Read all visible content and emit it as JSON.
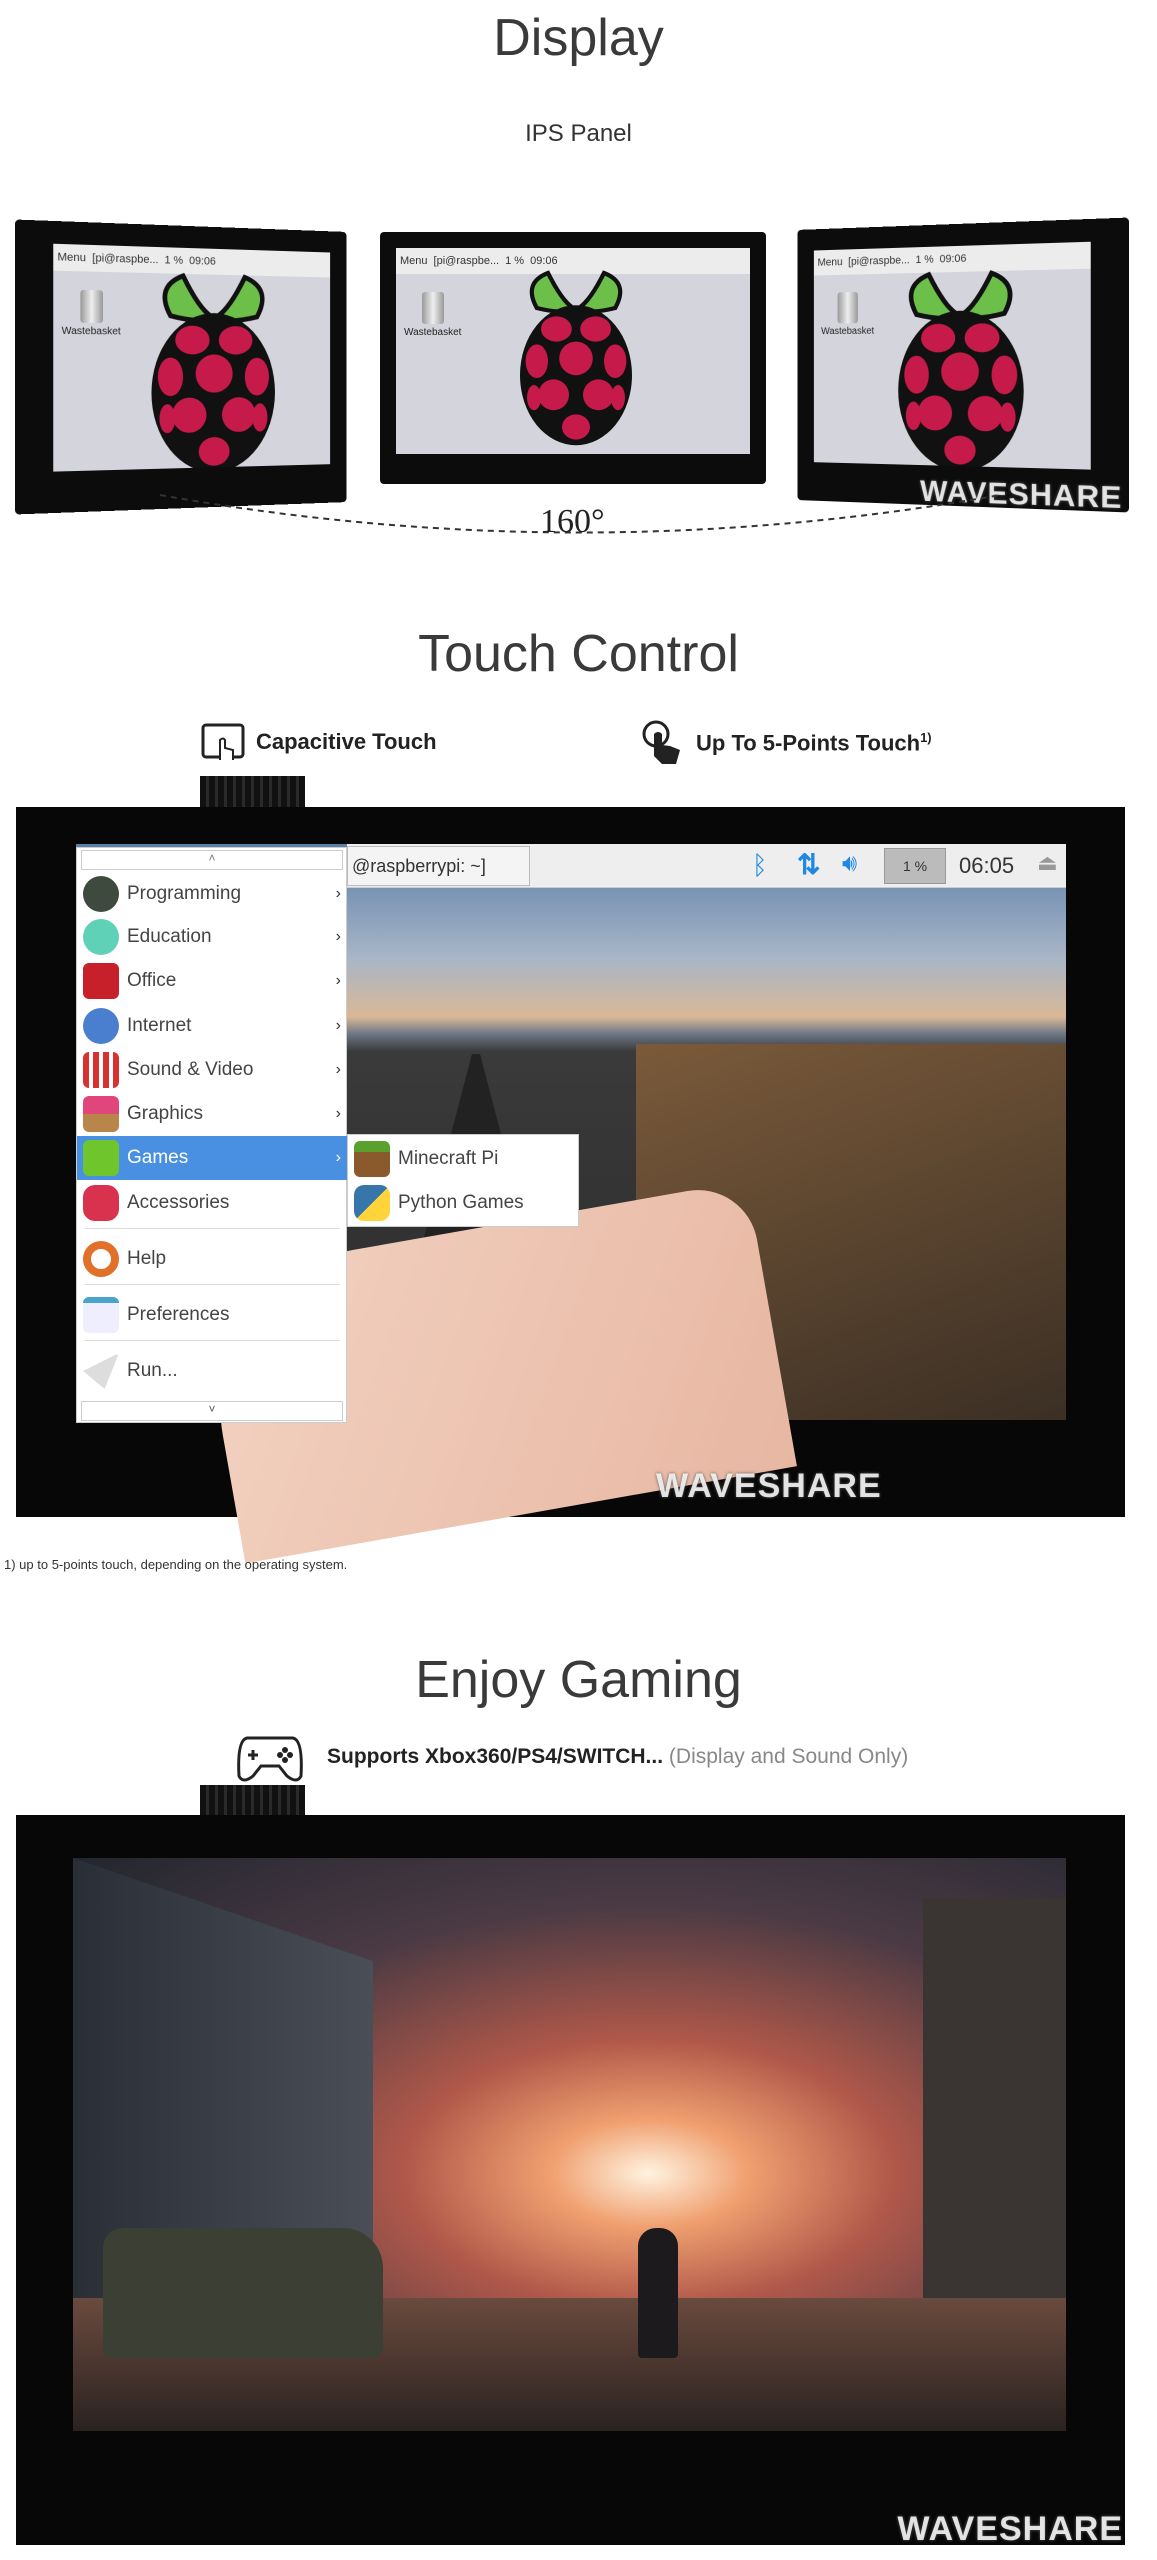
{
  "display": {
    "title": "Display",
    "subtitle": "IPS Panel",
    "angle": "160°",
    "screen": {
      "menu": "Menu",
      "terminal": "[pi@raspbe...",
      "cpu": "1 %",
      "time": "09:06",
      "desktop_icon": "Wastebasket"
    }
  },
  "touch": {
    "title": "Touch Control",
    "features": [
      {
        "label": "Capacitive Touch",
        "icon": "tablet-touch-icon"
      },
      {
        "label": "Up To 5-Points Touch",
        "sup": "1)",
        "icon": "multi-touch-hand-icon"
      }
    ],
    "taskbar": {
      "terminal": "@raspberrypi: ~]",
      "cpu": "1 %",
      "time": "06:05"
    },
    "menu": {
      "items": [
        {
          "label": "Programming",
          "icon": "programming-icon",
          "color": "#3d4a3d",
          "submenu": true
        },
        {
          "label": "Education",
          "icon": "education-icon",
          "color": "#5fd1b7",
          "submenu": true
        },
        {
          "label": "Office",
          "icon": "office-icon",
          "color": "#c8202a",
          "submenu": true
        },
        {
          "label": "Internet",
          "icon": "internet-icon",
          "color": "#4a7fd0",
          "submenu": true
        },
        {
          "label": "Sound & Video",
          "icon": "sound-video-icon",
          "color": "#d9322e",
          "submenu": true
        },
        {
          "label": "Graphics",
          "icon": "graphics-icon",
          "color": "#e0457b",
          "submenu": true
        },
        {
          "label": "Games",
          "icon": "games-icon",
          "color": "#6ec52c",
          "submenu": true,
          "selected": true
        },
        {
          "label": "Accessories",
          "icon": "accessories-icon",
          "color": "#d9324e",
          "submenu": false
        },
        {
          "label": "Help",
          "icon": "help-icon",
          "color": "#e0702a",
          "submenu": false
        },
        {
          "label": "Preferences",
          "icon": "preferences-icon",
          "color": "#4aa3c8",
          "submenu": false
        },
        {
          "label": "Run...",
          "icon": "run-icon",
          "color": "#999999",
          "submenu": false
        }
      ]
    },
    "submenu": {
      "items": [
        {
          "label": "Minecraft Pi",
          "icon": "minecraft-icon"
        },
        {
          "label": "Python Games",
          "icon": "python-icon"
        }
      ]
    },
    "footnote": "1) up to 5-points touch, depending on the operating system."
  },
  "gaming": {
    "title": "Enjoy Gaming",
    "support": "Supports Xbox360/PS4/SWITCH...",
    "support_note": "(Display and Sound Only)",
    "icon": "gamepad-icon"
  },
  "watermark": "WAVESHARE",
  "colors": {
    "accent": "#4a90e2",
    "raspberry": "#c51a4a",
    "leaf": "#6cc04a"
  }
}
